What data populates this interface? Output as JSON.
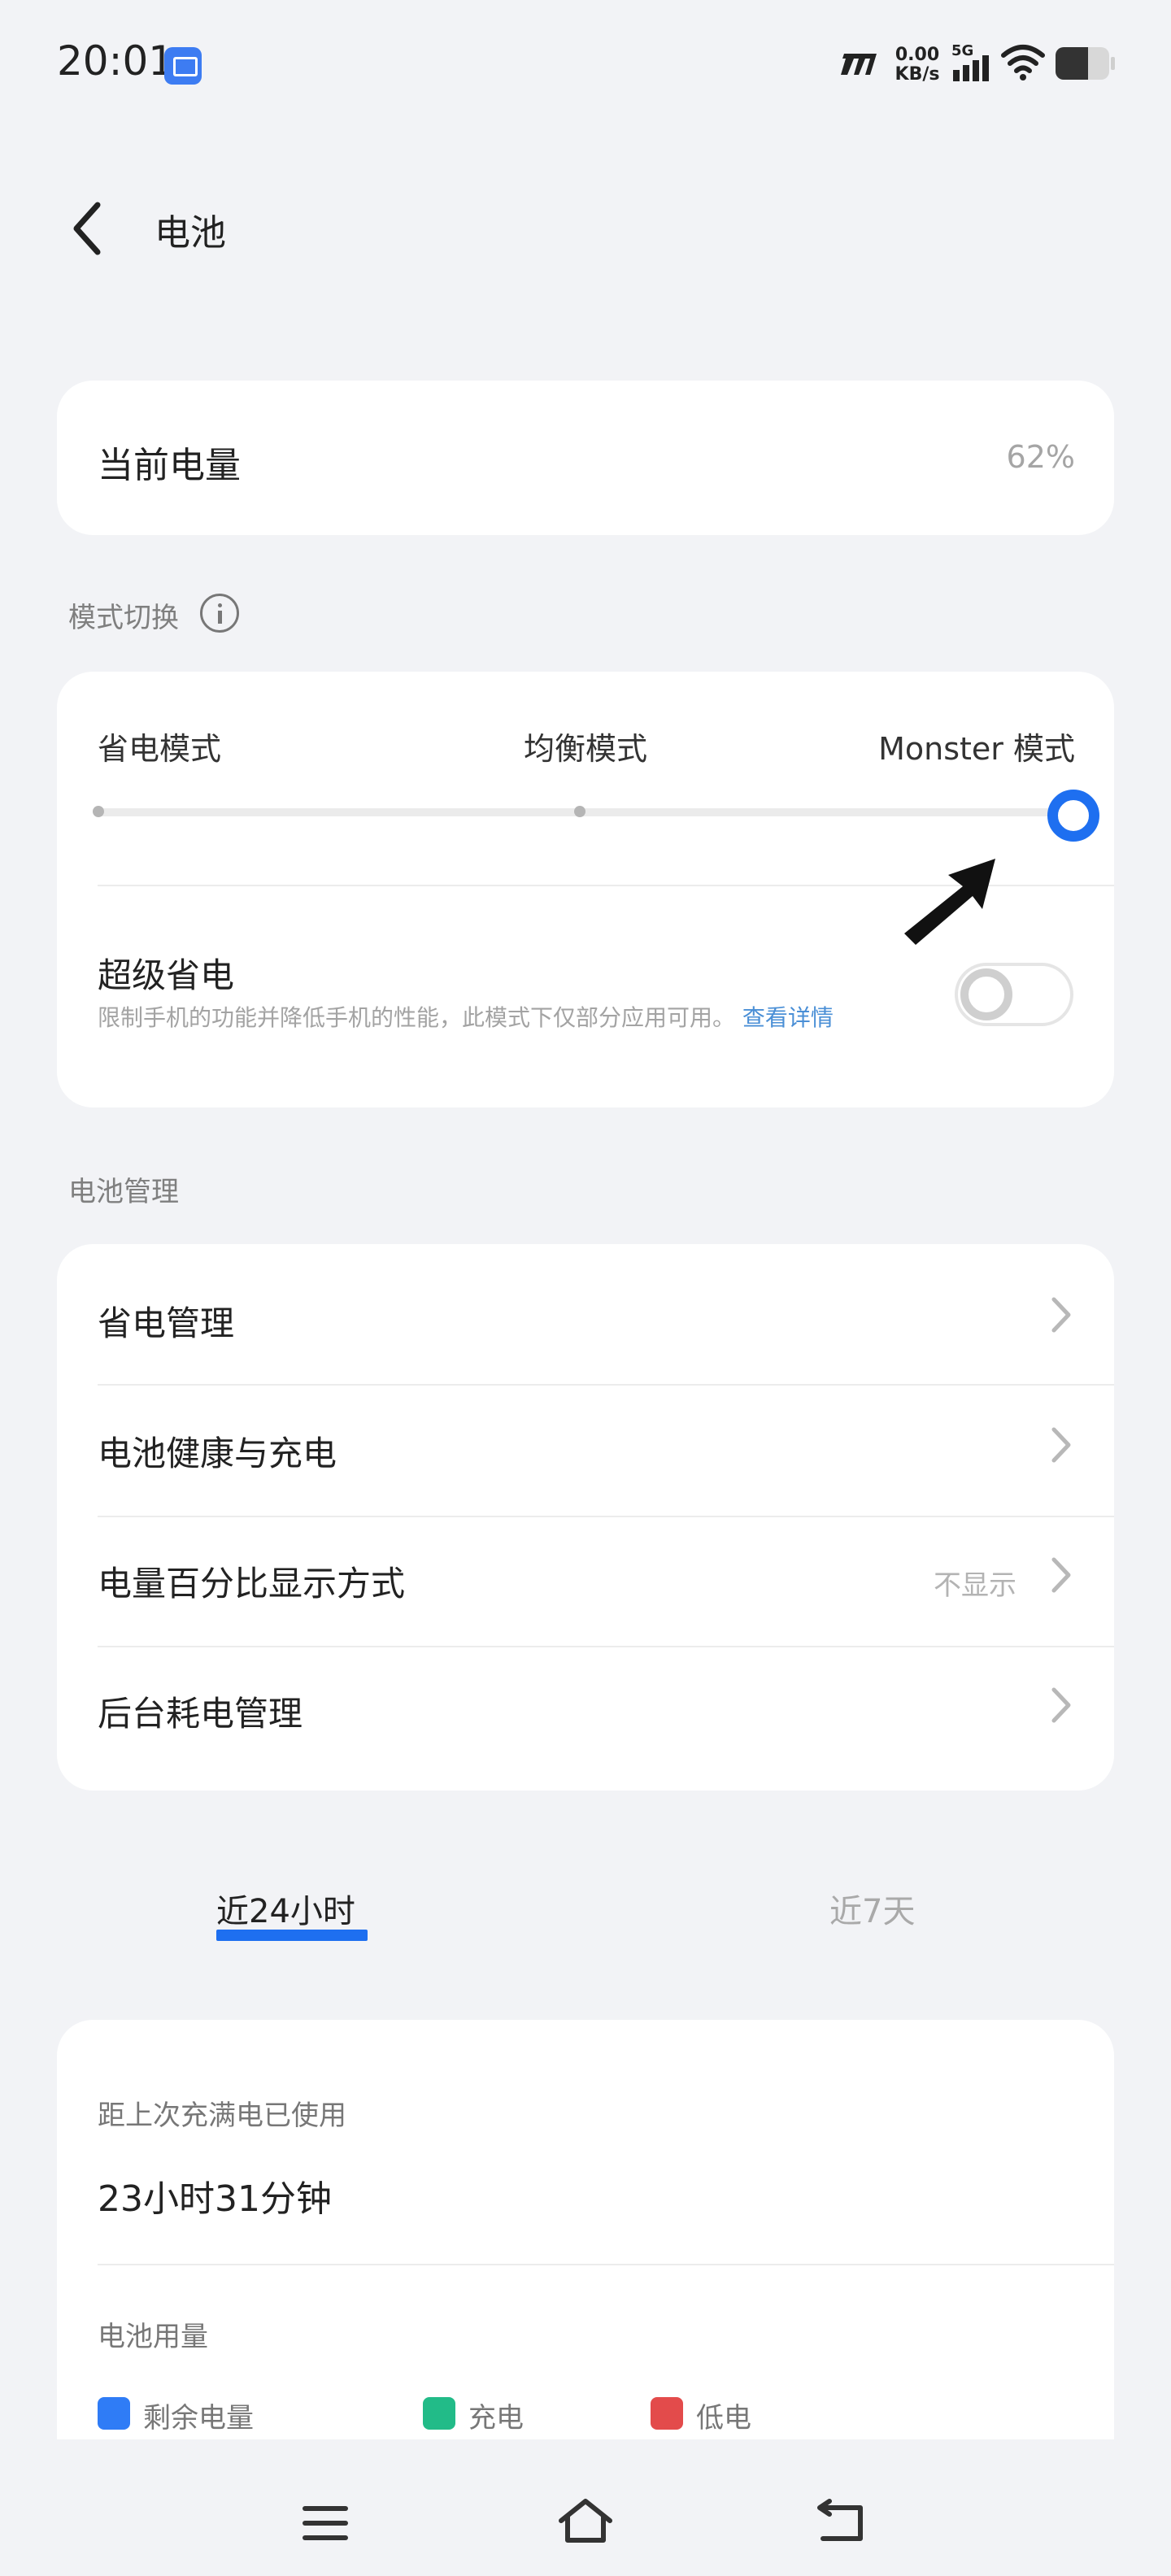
{
  "status_bar": {
    "time": "20:01",
    "net_speed_value": "0.00",
    "net_speed_unit": "KB/s",
    "network_type": "5G",
    "icons": [
      "screen-cast-icon",
      "carrier-icon",
      "signal-icon",
      "wifi-icon",
      "battery-icon"
    ]
  },
  "header": {
    "title": "电池",
    "back_icon": "back-icon"
  },
  "current": {
    "label": "当前电量",
    "value": "62%"
  },
  "mode": {
    "section_label": "模式切换",
    "options": [
      "省电模式",
      "均衡模式",
      "Monster 模式"
    ],
    "selected_index": 2,
    "accent_color": "#1e6ff0",
    "super_saver": {
      "label": "超级省电",
      "description": "限制手机的功能并降低手机的性能，此模式下仅部分应用可用。",
      "link": "查看详情",
      "enabled": false
    }
  },
  "manage": {
    "section_label": "电池管理",
    "items": [
      {
        "label": "省电管理",
        "value": ""
      },
      {
        "label": "电池健康与充电",
        "value": ""
      },
      {
        "label": "电量百分比显示方式",
        "value": "不显示"
      },
      {
        "label": "后台耗电管理",
        "value": ""
      }
    ]
  },
  "tabs": {
    "items": [
      "近24小时",
      "近7天"
    ],
    "active_index": 0
  },
  "usage": {
    "since_full_label": "距上次充满电已使用",
    "since_full_value": "23小时31分钟",
    "chart_title": "电池用量",
    "legend": [
      {
        "label": "剩余电量",
        "color": "#2f7cf6"
      },
      {
        "label": "充电",
        "color": "#22bb88"
      },
      {
        "label": "低电",
        "color": "#e34b4b"
      }
    ]
  },
  "nav": {
    "icons": [
      "menu-icon",
      "home-icon",
      "back-nav-icon"
    ]
  }
}
